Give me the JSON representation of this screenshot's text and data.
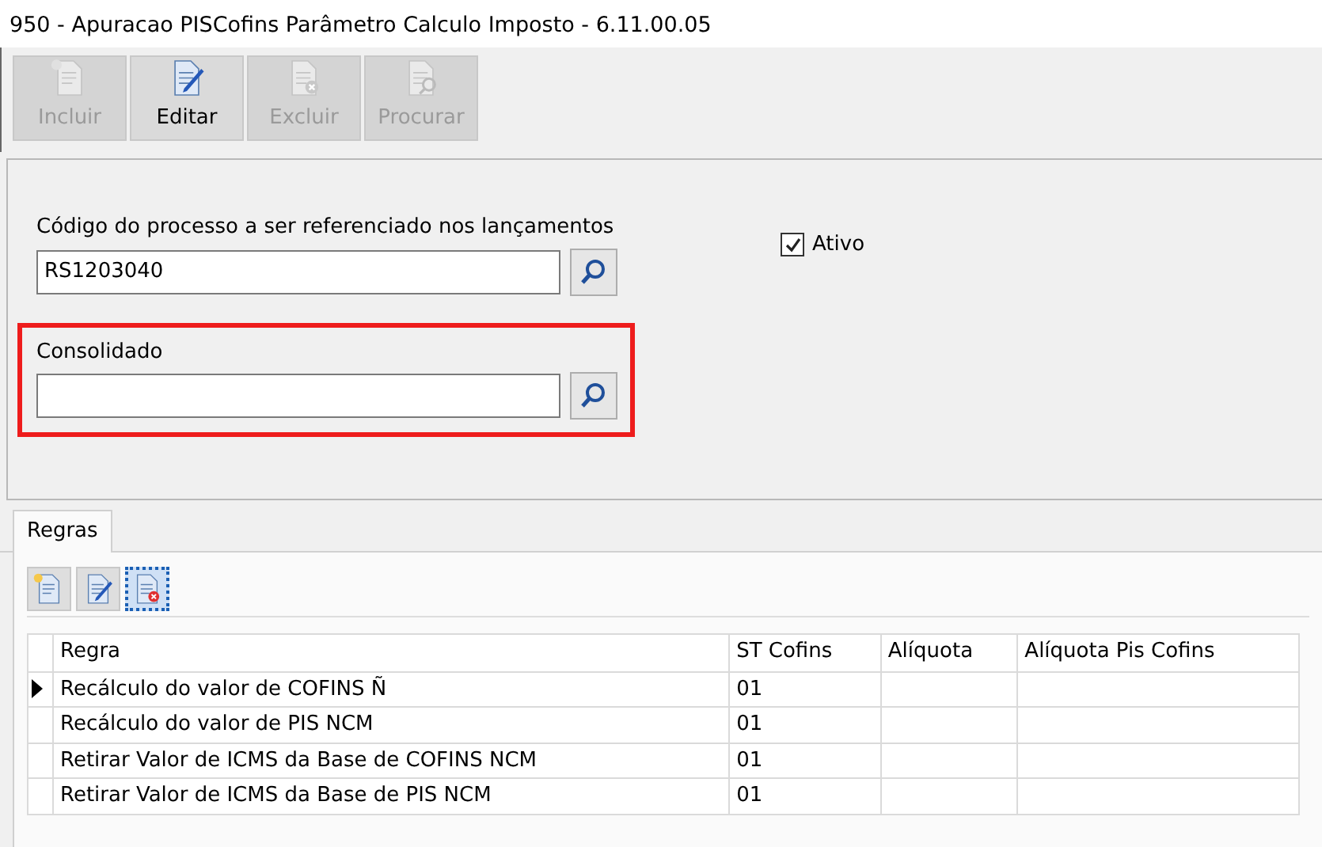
{
  "window": {
    "title": "950 - Apuracao PISCofins Parâmetro Calculo Imposto - 6.11.00.05"
  },
  "toolbar": [
    {
      "kind": "add",
      "label": "Incluir",
      "disabled": true
    },
    {
      "kind": "edit",
      "label": "Editar",
      "disabled": false
    },
    {
      "kind": "delete",
      "label": "Excluir",
      "disabled": true
    },
    {
      "kind": "find",
      "label": "Procurar",
      "disabled": true
    }
  ],
  "form": {
    "fields": [
      {
        "label": "Código do processo a ser referenciado nos lançamentos",
        "value": "RS1203040"
      },
      {
        "label": "Consolidado",
        "highlighted": true
      }
    ],
    "ativo": {
      "label": "Ativo",
      "checked": true
    }
  },
  "tabs": [
    {
      "label": "Regras",
      "selected": true
    }
  ],
  "grid_toolbar": [
    {
      "kind": "add",
      "selected": false
    },
    {
      "kind": "edit",
      "selected": false
    },
    {
      "kind": "delete",
      "selected": true
    }
  ],
  "table": {
    "columns": [
      "Regra",
      "ST Cofins",
      "Alíquota",
      "Alíquota Pis Cofins"
    ],
    "rows": [
      {
        "cells": [
          "Recálculo do valor de COFINS Ñ",
          "01",
          null,
          null
        ],
        "selected": true
      },
      {
        "cells": [
          "Recálculo do valor de PIS NCM",
          "01",
          null,
          null
        ],
        "selected": false
      },
      {
        "cells": [
          "Retirar Valor de ICMS da Base de COFINS NCM",
          "01",
          null,
          null
        ],
        "selected": false
      },
      {
        "cells": [
          "Retirar Valor de ICMS da Base de PIS NCM",
          "01",
          null,
          null
        ],
        "selected": false
      }
    ]
  }
}
